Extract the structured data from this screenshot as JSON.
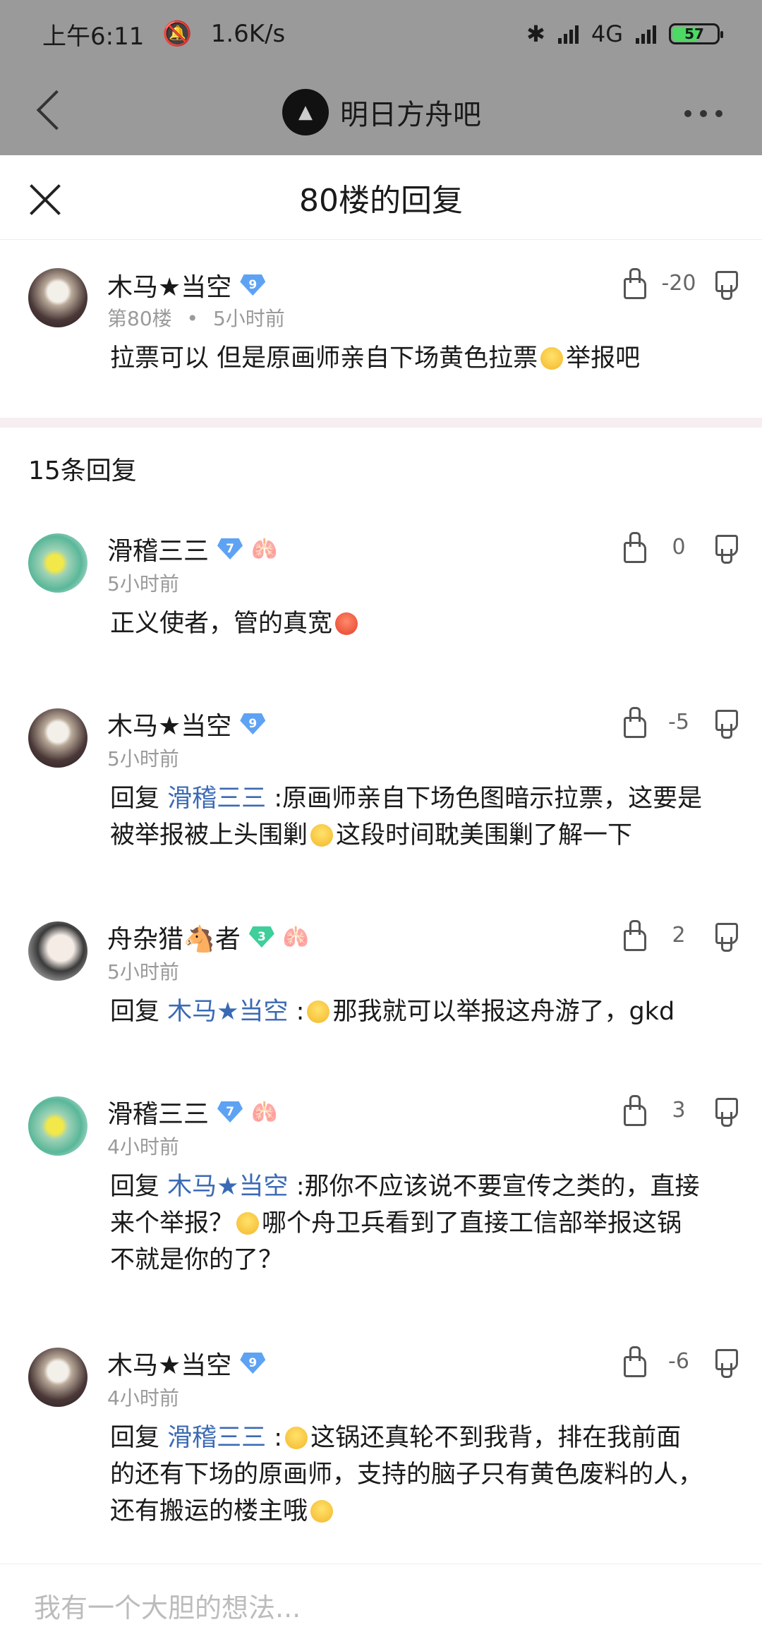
{
  "status_bar": {
    "time": "上午6:11",
    "speed": "1.6K/s",
    "network": "4G",
    "battery": "57"
  },
  "forum": {
    "title": "明日方舟吧"
  },
  "panel": {
    "title": "80楼的回复",
    "replies_count": "15条回复",
    "input_placeholder": "我有一个大胆的想法..."
  },
  "main_post": {
    "author": "木马★当空",
    "level": "9",
    "floor": "第80楼",
    "dot": "•",
    "time": "5小时前",
    "text": "拉票可以 但是原画师亲自下场黄色拉票",
    "text_after": "举报吧",
    "votes": "-20"
  },
  "replies": [
    {
      "author": "滑稽三三",
      "level": "7",
      "time": "5小时前",
      "prefix": "",
      "mention": "",
      "text": "正义使者，管的真宽",
      "votes": "0"
    },
    {
      "author": "木马★当空",
      "level": "9",
      "time": "5小时前",
      "prefix": "回复",
      "mention": "滑稽三三",
      "text_line1": ":原画师亲自下场色图暗示拉票，这要是",
      "text_line2a": "被举报被上头围剿",
      "text_line2b": "这段时间耽美围剿了解一下",
      "votes": "-5"
    },
    {
      "author_a": "舟杂猎",
      "author_b": "者",
      "level": "3",
      "time": "5小时前",
      "prefix": "回复",
      "mention": "木马★当空",
      "text": "那我就可以举报这舟游了，gkd",
      "votes": "2"
    },
    {
      "author": "滑稽三三",
      "level": "7",
      "time": "4小时前",
      "prefix": "回复",
      "mention": "木马★当空",
      "text_line1": ":那你不应该说不要宣传之类的，直接",
      "text_line2a": "来个举报？",
      "text_line2b": "哪个舟卫兵看到了直接工信部举报这锅",
      "text_line3": "不就是你的了？",
      "votes": "3"
    },
    {
      "author": "木马★当空",
      "level": "9",
      "time": "4小时前",
      "prefix": "回复",
      "mention": "滑稽三三",
      "text_line1": "这锅还真轮不到我背，排在我前面",
      "text_line2": "的还有下场的原画师，支持的脑子只有黄色废料的人，",
      "text_line3": "还有搬运的楼主哦",
      "votes": "-6"
    }
  ],
  "colors": {
    "mention": "#3b6ab4",
    "meta": "#9a9a9a",
    "dim_overlay": "#9a9a9a"
  }
}
